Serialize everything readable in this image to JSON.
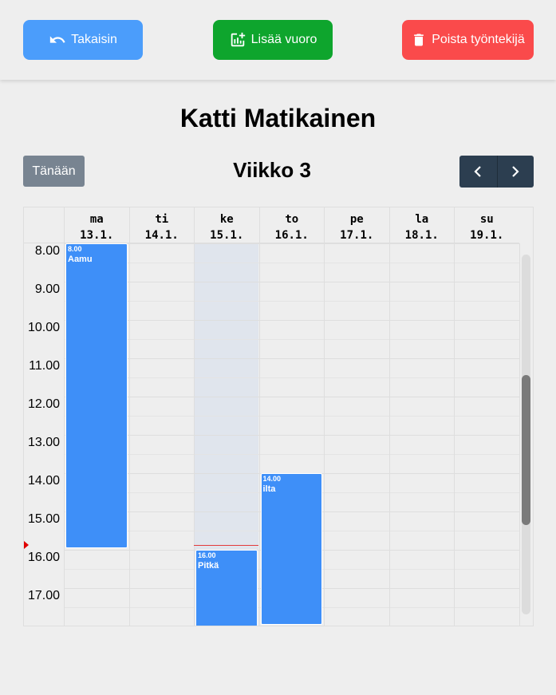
{
  "toolbar": {
    "back_label": "Takaisin",
    "add_shift_label": "Lisää vuoro",
    "delete_employee_label": "Poista työntekijä",
    "colors": {
      "back": "#4b9dfb",
      "add": "#0ea52d",
      "delete": "#fa4a4b"
    },
    "icons": {
      "back": "undo-arrow-icon",
      "add": "add-chart-icon",
      "delete": "trash-icon"
    }
  },
  "employee": {
    "name": "Katti Matikainen"
  },
  "calendar_toolbar": {
    "today_label": "Tänään",
    "week_title": "Viikko 3",
    "icons": {
      "prev": "chevron-left-icon",
      "next": "chevron-right-icon"
    }
  },
  "calendar": {
    "days": [
      {
        "abbr": "ma",
        "date": "13.1."
      },
      {
        "abbr": "ti",
        "date": "14.1."
      },
      {
        "abbr": "ke",
        "date": "15.1.",
        "today": true
      },
      {
        "abbr": "to",
        "date": "16.1."
      },
      {
        "abbr": "pe",
        "date": "17.1."
      },
      {
        "abbr": "la",
        "date": "18.1."
      },
      {
        "abbr": "su",
        "date": "19.1."
      }
    ],
    "times": [
      "8.00",
      "9.00",
      "10.00",
      "11.00",
      "12.00",
      "13.00",
      "14.00",
      "15.00",
      "16.00",
      "17.00"
    ],
    "events": [
      {
        "day": 0,
        "time": "8.00",
        "title": "Aamu"
      },
      {
        "day": 2,
        "time": "16.00",
        "title": "Pitkä"
      },
      {
        "day": 3,
        "time": "14.00",
        "title": "ilta"
      }
    ],
    "event_color": "#3e8ff8",
    "today_highlight_color": "#e0e5ed",
    "now_indicator_color": "#e00000"
  }
}
